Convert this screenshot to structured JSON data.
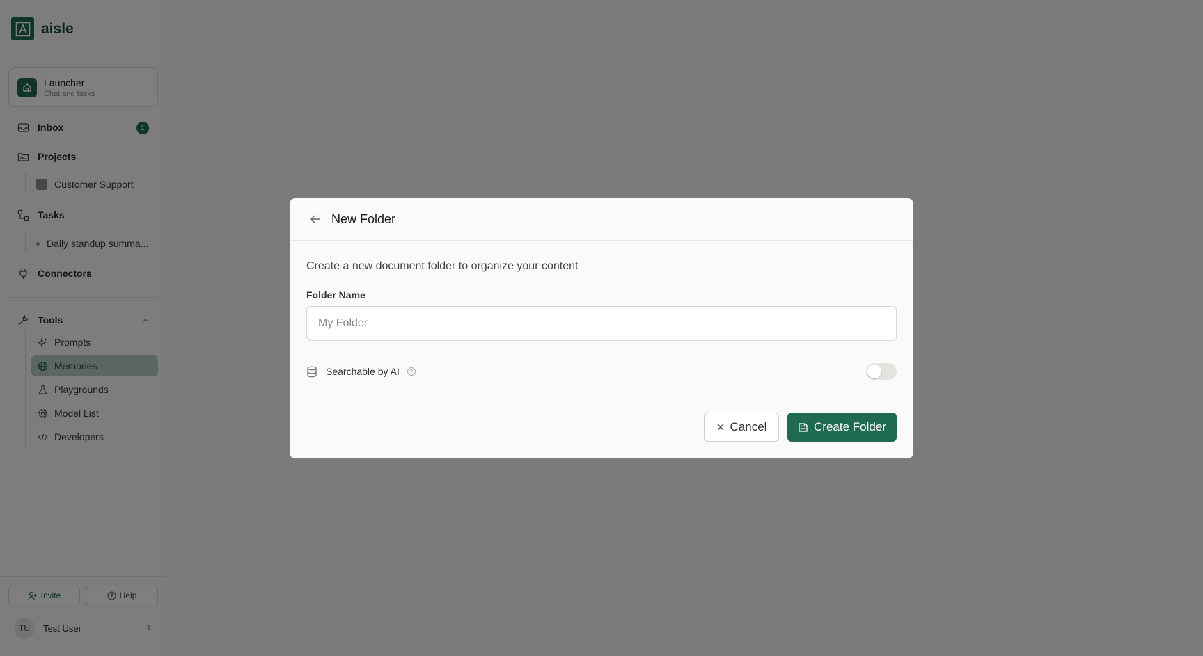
{
  "brand": {
    "name": "aisle"
  },
  "launcher": {
    "title": "Launcher",
    "subtitle": "Chat and tasks"
  },
  "nav": {
    "inbox": {
      "label": "Inbox",
      "badge": "1"
    },
    "projects": {
      "label": "Projects",
      "items": [
        "Customer Support"
      ]
    },
    "tasks": {
      "label": "Tasks",
      "items": [
        "Daily standup summa..."
      ]
    },
    "connectors": {
      "label": "Connectors"
    },
    "tools": {
      "label": "Tools",
      "items": [
        "Prompts",
        "Memories",
        "Playgrounds",
        "Model List",
        "Developers"
      ],
      "active": "Memories"
    }
  },
  "footer": {
    "invite": "Invite",
    "help": "Help",
    "user_initials": "TU",
    "user_name": "Test User"
  },
  "modal": {
    "title": "New Folder",
    "description": "Create a new document folder to organize your content",
    "field_label": "Folder Name",
    "field_value": "",
    "field_placeholder": "My Folder",
    "searchable_label": "Searchable by AI",
    "searchable_on": false,
    "cancel_label": "Cancel",
    "create_label": "Create Folder"
  },
  "colors": {
    "accent": "#1f6b52",
    "overlay": "rgba(0,0,0,0.5)"
  }
}
